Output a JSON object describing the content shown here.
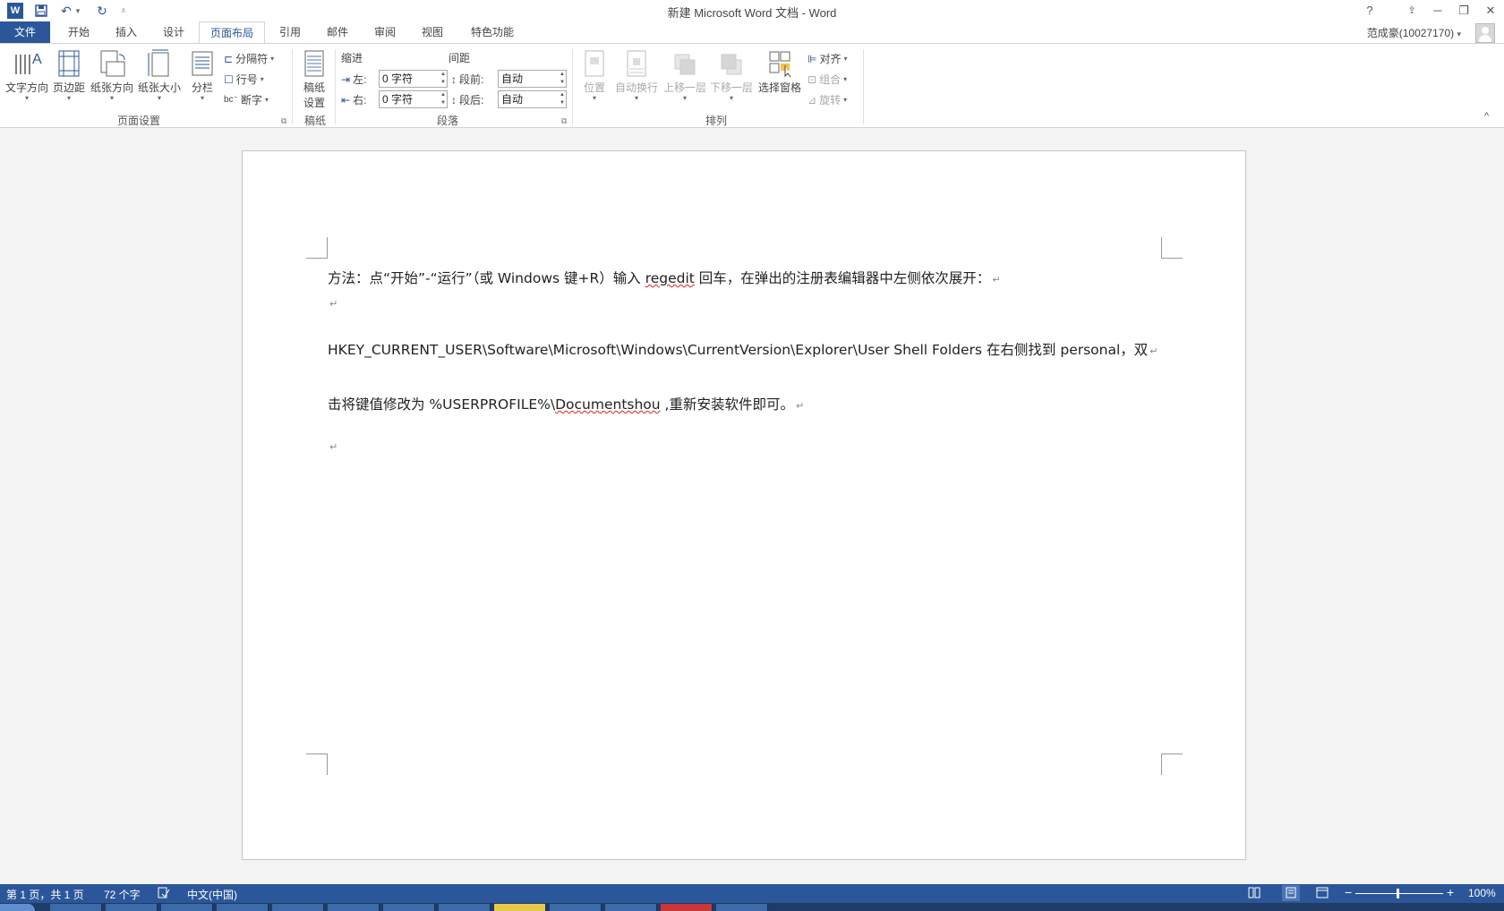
{
  "window": {
    "title": "新建 Microsoft Word 文档 - Word",
    "help": "?",
    "minimize": "─",
    "restore": "❐",
    "close": "✕",
    "ribbon_display": "⇪"
  },
  "quick_access": {
    "word_icon": "W",
    "save": "💾",
    "undo": "↶",
    "undo_drop": "▾",
    "redo": "↻",
    "customize": "⩡"
  },
  "tabs": [
    {
      "label": "文件"
    },
    {
      "label": "开始"
    },
    {
      "label": "插入"
    },
    {
      "label": "设计"
    },
    {
      "label": "页面布局"
    },
    {
      "label": "引用"
    },
    {
      "label": "邮件"
    },
    {
      "label": "审阅"
    },
    {
      "label": "视图"
    },
    {
      "label": "特色功能"
    }
  ],
  "user": {
    "name": "范成豪(10027170)",
    "drop": "▾"
  },
  "ribbon": {
    "page_setup": {
      "group_label": "页面设置",
      "text_direction": "文字方向",
      "margins": "页边距",
      "orientation": "纸张方向",
      "size": "纸张大小",
      "columns": "分栏",
      "breaks": "分隔符",
      "line_numbers": "行号",
      "hyphenation": "断字"
    },
    "draft_paper": {
      "group_label": "稿纸",
      "button_line1": "稿纸",
      "button_line2": "设置"
    },
    "paragraph": {
      "group_label": "段落",
      "indent_header": "缩进",
      "spacing_header": "间距",
      "left_label": "左:",
      "right_label": "右:",
      "left_value": "0 字符",
      "right_value": "0 字符",
      "before_label": "段前:",
      "after_label": "段后:",
      "before_value": "自动",
      "after_value": "自动"
    },
    "arrange": {
      "group_label": "排列",
      "position": "位置",
      "wrap_text": "自动换行",
      "bring_forward": "上移一层",
      "send_backward": "下移一层",
      "selection_pane": "选择窗格",
      "align": "对齐",
      "group": "组合",
      "rotate": "旋转"
    },
    "collapse": "^"
  },
  "document": {
    "para1": {
      "before": "方法：点“开始”-“运行”（或 Windows 键+R）输入 ",
      "squiggle": "regedit",
      "after": " 回车，在弹出的注册表编辑器中左侧依次展开："
    },
    "para3": "HKEY_CURRENT_USER\\Software\\Microsoft\\Windows\\CurrentVersion\\Explorer\\User Shell Folders  在右侧找到 personal，双",
    "para4": {
      "before": "击将键值修改为  %USERPROFILE%\\",
      "squiggle": "Documentshou",
      "after": " ,重新安装软件即可。"
    },
    "para_mark": "↵"
  },
  "status": {
    "page": "第 1 页，共 1 页",
    "words": "72 个字",
    "language": "中文(中国)",
    "zoom": "100%",
    "zoom_minus": "−",
    "zoom_plus": "+"
  }
}
